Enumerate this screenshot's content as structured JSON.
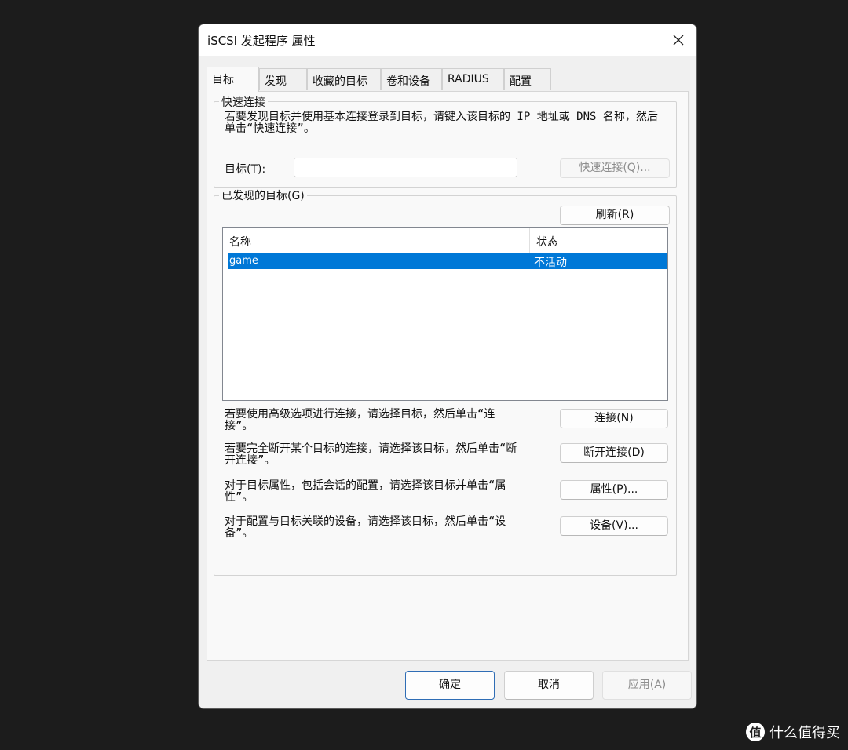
{
  "window": {
    "title": "iSCSI 发起程序 属性",
    "close_icon": "close-icon"
  },
  "tabs": [
    {
      "label": "目标",
      "active": true
    },
    {
      "label": "发现",
      "active": false
    },
    {
      "label": "收藏的目标",
      "active": false
    },
    {
      "label": "卷和设备",
      "active": false
    },
    {
      "label": "RADIUS",
      "active": false
    },
    {
      "label": "配置",
      "active": false
    }
  ],
  "quick_connect": {
    "group_title": "快速连接",
    "description": "若要发现目标并使用基本连接登录到目标，请键入该目标的 IP 地址或 DNS 名称，然后单击“快速连接”。",
    "target_label": "目标(T):",
    "target_value": "",
    "button_label": "快速连接(Q)..."
  },
  "discovered": {
    "group_title": "已发现的目标(G)",
    "refresh_label": "刷新(R)",
    "columns": [
      "名称",
      "状态"
    ],
    "rows": [
      {
        "name": "game",
        "status": "不活动",
        "selected": true
      }
    ]
  },
  "actions": [
    {
      "text": "若要使用高级选项进行连接，请选择目标，然后单击“连接”。",
      "button": "连接(N)"
    },
    {
      "text": "若要完全断开某个目标的连接，请选择该目标，然后单击“断开连接”。",
      "button": "断开连接(D)"
    },
    {
      "text": "对于目标属性，包括会话的配置，请选择该目标并单击“属性”。",
      "button": "属性(P)..."
    },
    {
      "text": "对于配置与目标关联的设备，请选择该目标，然后单击“设备”。",
      "button": "设备(V)..."
    }
  ],
  "footer": {
    "ok": "确定",
    "cancel": "取消",
    "apply": "应用(A)"
  },
  "watermark": {
    "logo_text": "值",
    "text": "什么值得买"
  },
  "colors": {
    "selection": "#0078d7",
    "background": "#1c1c1c",
    "dialog": "#f0f0f0",
    "primary_border": "#2f6db5"
  }
}
